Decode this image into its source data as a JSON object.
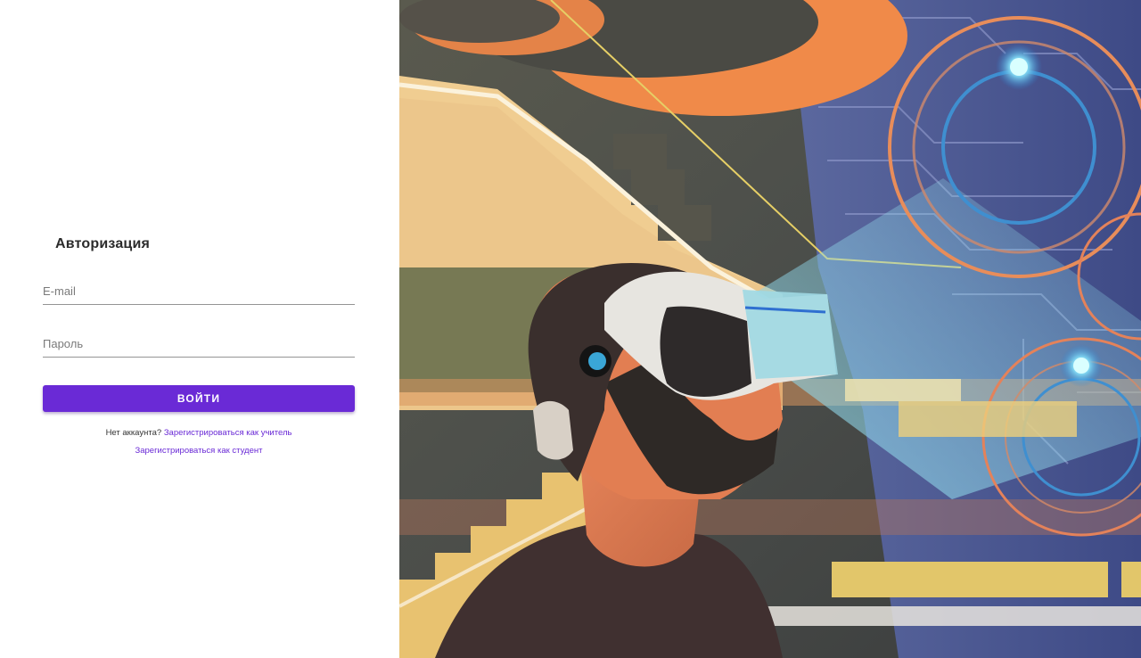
{
  "login": {
    "title": "Авторизация",
    "email_placeholder": "E-mail",
    "password_placeholder": "Пароль",
    "submit_label": "ВОЙТИ",
    "no_account_text": "Нет аккаунта?",
    "register_teacher_link": "Зарегистрироваться как учитель",
    "register_student_link": "Зарегистрироваться как студент"
  },
  "hero": {
    "image_icon": "vr-headset-illustration"
  },
  "colors": {
    "accent": "#6a2ad6",
    "field_line": "#949494",
    "title": "#2b2b2b"
  }
}
